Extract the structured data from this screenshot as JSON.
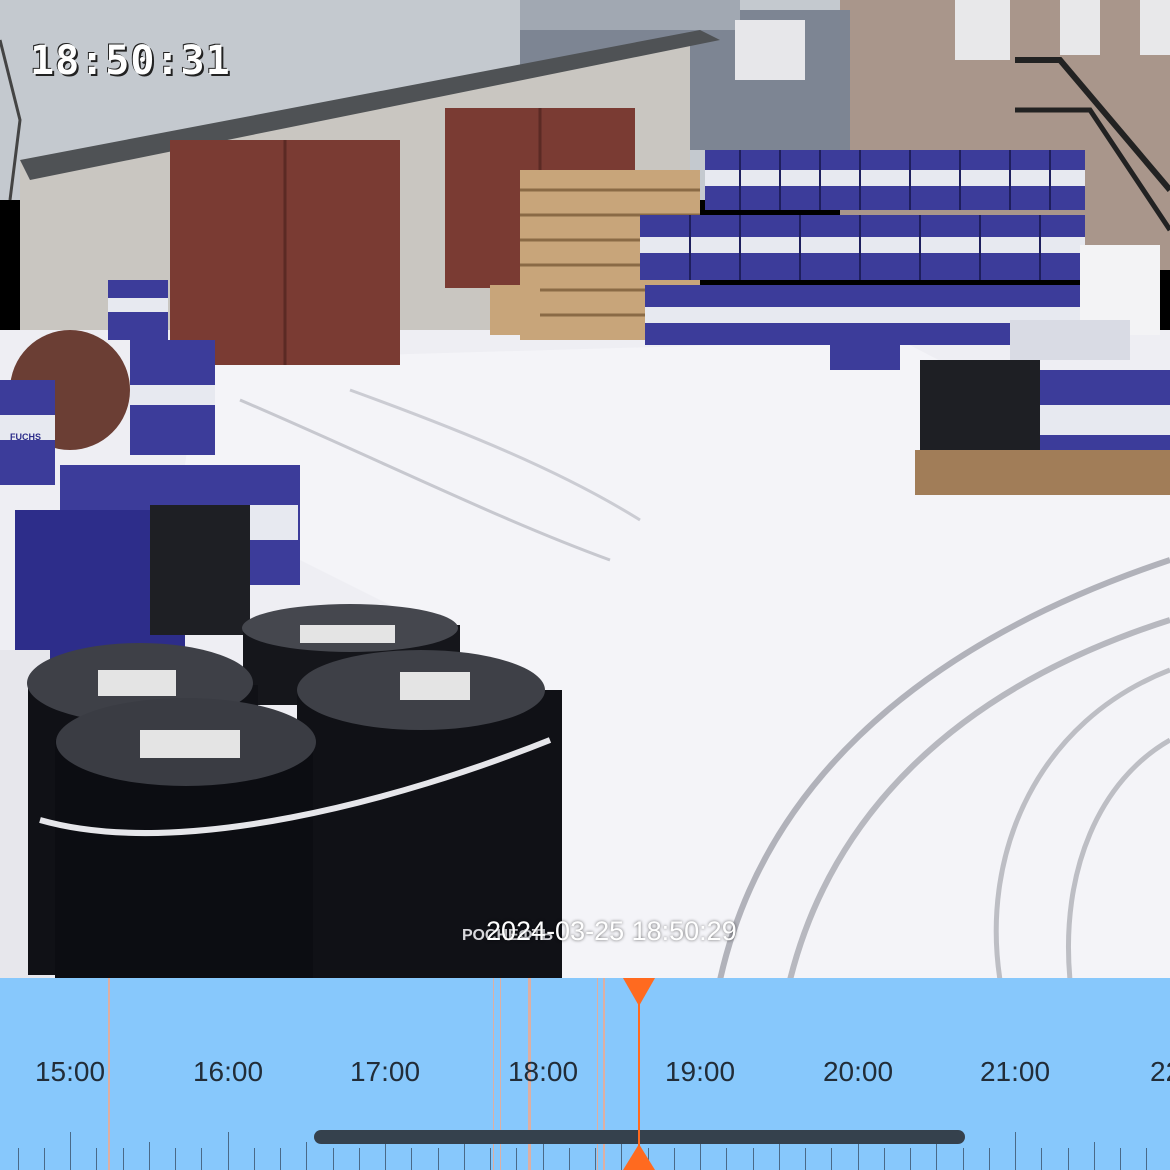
{
  "camera": {
    "osd_time": "18:50:31",
    "playback_timestamp": "2024-03-25 18:50:29"
  },
  "timeline": {
    "hour_labels": [
      "15:00",
      "16:00",
      "17:00",
      "18:00",
      "19:00",
      "20:00",
      "21:00",
      "22"
    ],
    "playhead_time": "18:50:29"
  },
  "barrel_labels": {
    "rosneft": "РОСНЕФТЬ",
    "fuchs": "FUCHS"
  },
  "colors": {
    "timeline_bg": "#87c8fc",
    "playhead": "#ff6a1f",
    "recording_marker": "#f2a98b",
    "scrollbar": "#35414d"
  },
  "icons": {
    "playhead_top": "triangle-down",
    "playhead_bottom": "triangle-up"
  }
}
